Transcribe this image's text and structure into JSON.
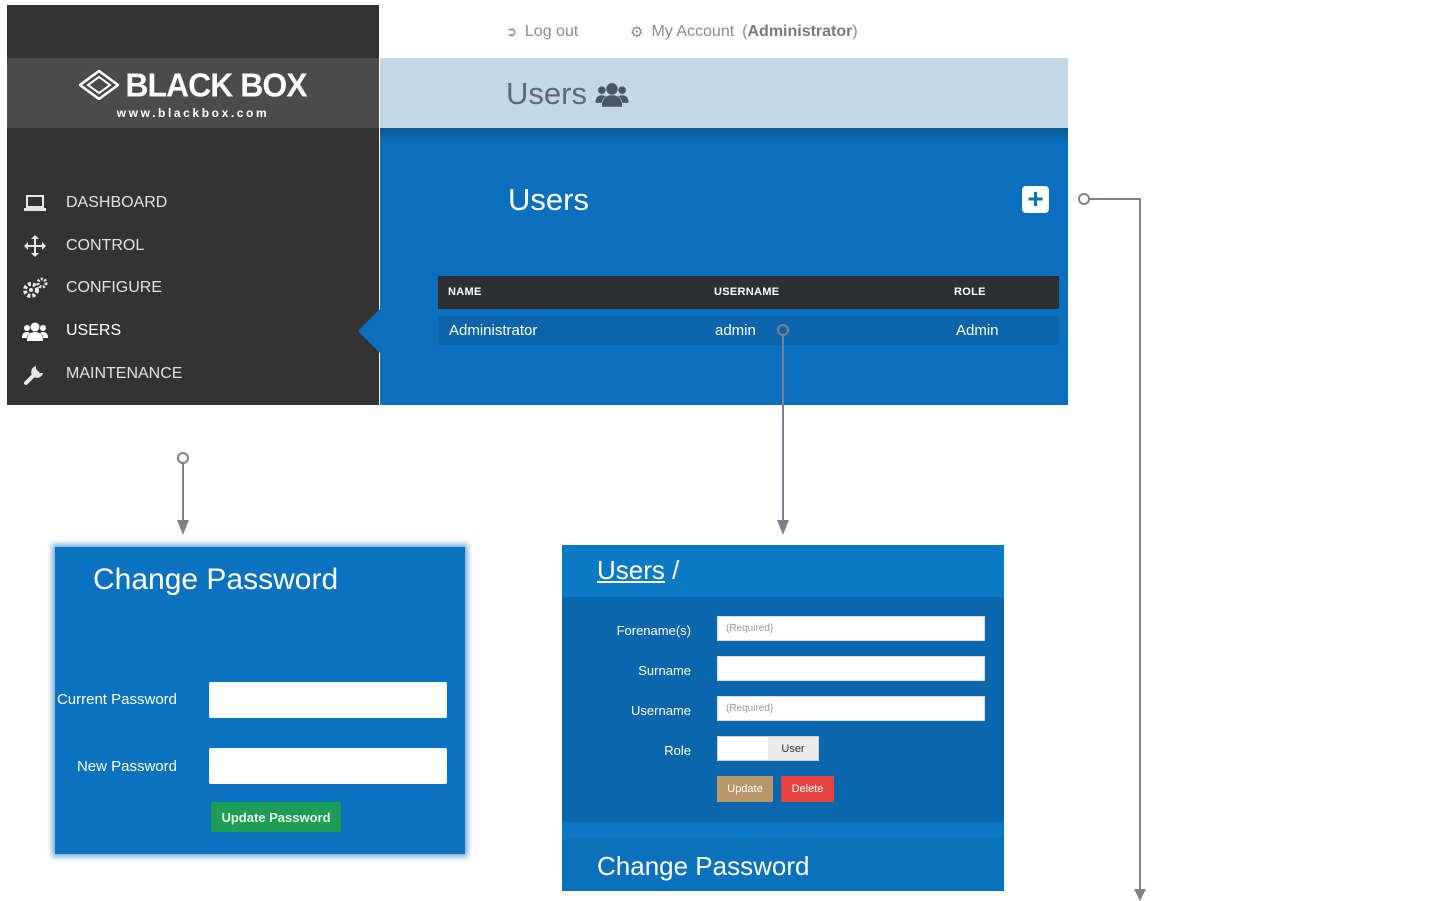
{
  "topbar": {
    "logout_label": "Log out",
    "account_label": "My Account",
    "account_role": "Administrator"
  },
  "brand": {
    "logo_text": "BLACK BOX",
    "url": "www.blackbox.com"
  },
  "sidebar": {
    "items": [
      {
        "label": "DASHBOARD",
        "icon": "laptop-icon"
      },
      {
        "label": "CONTROL",
        "icon": "move-icon"
      },
      {
        "label": "CONFIGURE",
        "icon": "gears-icon"
      },
      {
        "label": "USERS",
        "icon": "users-icon",
        "active": true
      },
      {
        "label": "MAINTENANCE",
        "icon": "wrench-icon"
      }
    ]
  },
  "page": {
    "header_title": "Users",
    "panel_title": "Users"
  },
  "users_table": {
    "columns": [
      "NAME",
      "USERNAME",
      "ROLE"
    ],
    "rows": [
      {
        "name": "Administrator",
        "username": "admin",
        "role": "Admin"
      }
    ]
  },
  "change_password_dialog": {
    "title": "Change Password",
    "current_password_label": "Current Password",
    "new_password_label": "New Password",
    "submit_label": "Update Password"
  },
  "user_edit_dialog": {
    "breadcrumb_link": "Users",
    "breadcrumb_sep": "/",
    "forename_label": "Forename(s)",
    "forename_placeholder": "(Required)",
    "surname_label": "Surname",
    "username_label": "Username",
    "username_placeholder": "(Required)",
    "role_label": "Role",
    "role_value": "User",
    "update_label": "Update",
    "delete_label": "Delete",
    "change_password_heading": "Change Password"
  },
  "colors": {
    "sidebar_bg": "#333333",
    "panel_blue": "#0b6fbd",
    "header_band": "#c3d8e6",
    "update_password_green": "#1e9d55",
    "update_tan": "#b9956a",
    "delete_red": "#e8443f"
  }
}
